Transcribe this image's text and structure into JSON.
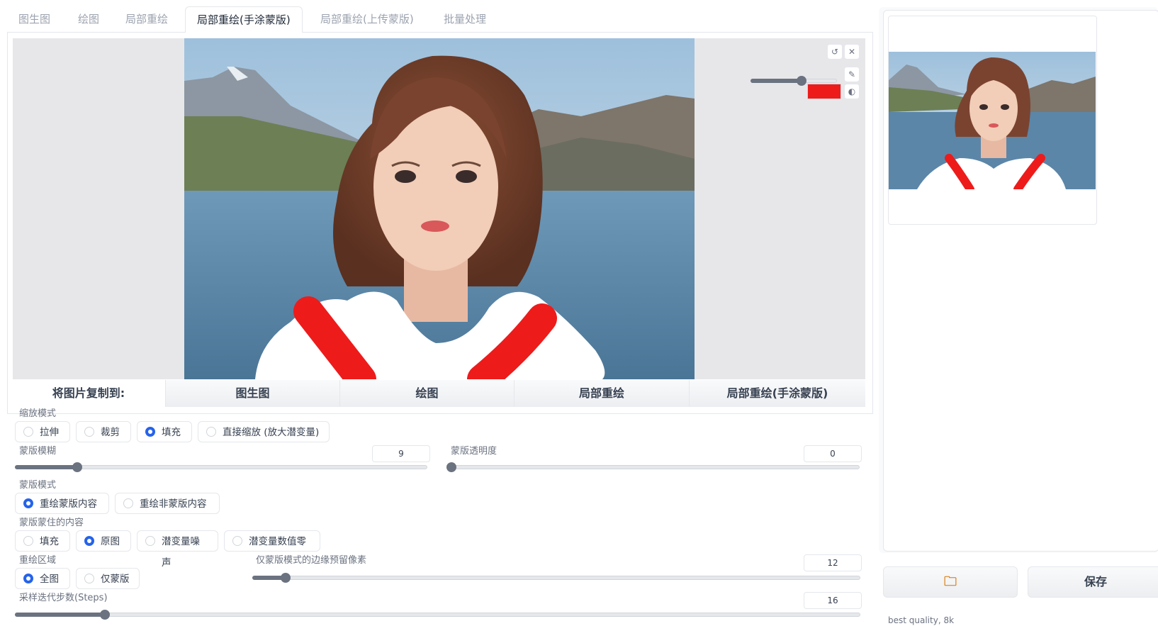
{
  "tabs": [
    {
      "label": "图生图"
    },
    {
      "label": "绘图"
    },
    {
      "label": "局部重绘"
    },
    {
      "label": "局部重绘(手涂蒙版)"
    },
    {
      "label": "局部重绘(上传蒙版)"
    },
    {
      "label": "批量处理"
    }
  ],
  "active_tab": 3,
  "canvas": {
    "tool_icons": [
      "undo-icon",
      "close-icon",
      "brush-icon",
      "palette-icon"
    ],
    "brush_color": "#ee1b1b",
    "brush_size_fraction": 0.58
  },
  "copy_bar": {
    "label": "将图片复制到:",
    "buttons": [
      "图生图",
      "绘图",
      "局部重绘",
      "局部重绘(手涂蒙版)"
    ]
  },
  "resize_mode": {
    "label": "缩放模式",
    "options": [
      "拉伸",
      "裁剪",
      "填充",
      "直接缩放 (放大潜变量)"
    ],
    "selected": 2
  },
  "mask_blur": {
    "label": "蒙版模糊",
    "value": "9",
    "fraction": 0.14
  },
  "mask_opacity": {
    "label": "蒙版透明度",
    "value": "0",
    "fraction": 0.0
  },
  "mask_mode": {
    "label": "蒙版模式",
    "options": [
      "重绘蒙版内容",
      "重绘非蒙版内容"
    ],
    "selected": 0
  },
  "masked_content": {
    "label": "蒙版蒙住的内容",
    "options": [
      "填充",
      "原图",
      "潜变量噪声",
      "潜变量数值零"
    ],
    "selected": 1
  },
  "inpaint_area": {
    "label": "重绘区域",
    "options": [
      "全图",
      "仅蒙版"
    ],
    "selected": 0
  },
  "only_masked_padding": {
    "label": "仅蒙版模式的边缘预留像素",
    "value": "12",
    "fraction": 0.05
  },
  "sampling_steps": {
    "label": "采样迭代步数(Steps)",
    "value": "16",
    "fraction": 0.11
  },
  "right_panel": {
    "folder_icon": "folder-icon",
    "save_label": "保存",
    "prompt_preview": "best quality, 8k"
  },
  "colors": {
    "accent_blue": "#2563eb",
    "sky": "#b9d2e6",
    "lake": "#5b86a8",
    "mask_red": "#ee1b1b",
    "mask_white": "#ffffff"
  }
}
